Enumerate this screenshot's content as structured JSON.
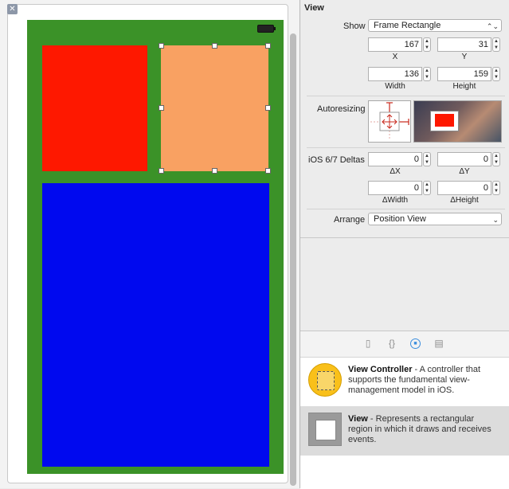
{
  "inspector": {
    "section_title": "View",
    "show_label": "Show",
    "show_value": "Frame Rectangle",
    "x_value": "167",
    "x_label": "X",
    "y_value": "31",
    "y_label": "Y",
    "width_value": "136",
    "width_label": "Width",
    "height_value": "159",
    "height_label": "Height",
    "autoresizing_label": "Autoresizing",
    "deltas_label": "iOS 6/7 Deltas",
    "dx_value": "0",
    "dx_label": "ΔX",
    "dy_value": "0",
    "dy_label": "ΔY",
    "dwidth_value": "0",
    "dwidth_label": "ΔWidth",
    "dheight_value": "0",
    "dheight_label": "ΔHeight",
    "arrange_label": "Arrange",
    "arrange_value": "Position View"
  },
  "library": {
    "tabs": [
      "file-template",
      "code-snippet",
      "object-library",
      "media-library"
    ],
    "items": [
      {
        "title": "View Controller",
        "description": " - A controller that supports the fundamental view-management model in iOS.",
        "icon": "view-controller-icon",
        "selected": false
      },
      {
        "title": "View",
        "description": " - Represents a rectangular region in which it draws and receives events.",
        "icon": "view-icon",
        "selected": true
      }
    ]
  },
  "canvas": {
    "views": [
      {
        "name": "red-view",
        "color": "#fe1800"
      },
      {
        "name": "orange-view",
        "color": "#f9a162",
        "selected": true
      },
      {
        "name": "blue-view",
        "color": "#0009ef"
      }
    ],
    "device_background": "#3b9228"
  }
}
